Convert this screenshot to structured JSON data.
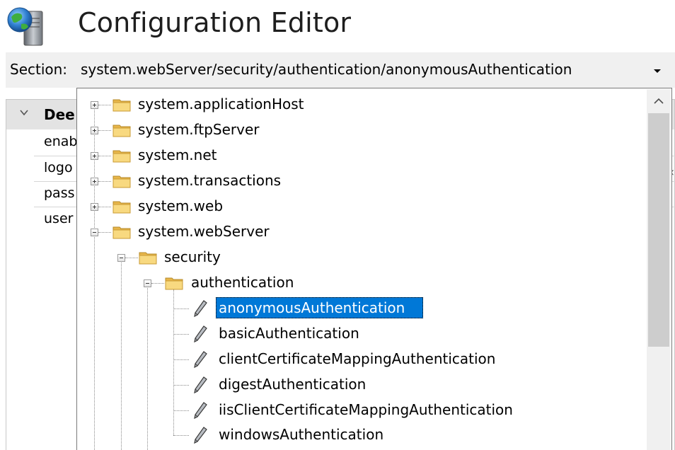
{
  "header": {
    "title": "Configuration Editor"
  },
  "section": {
    "label": "Section:",
    "value": "system.webServer/security/authentication/anonymousAuthentication"
  },
  "grid": {
    "group_label": "Dee",
    "rows": [
      "enab",
      "logo",
      "pass",
      "user"
    ]
  },
  "tree": {
    "nodes": [
      {
        "label": "system.applicationHost",
        "type": "folder",
        "state": "collapsed"
      },
      {
        "label": "system.ftpServer",
        "type": "folder",
        "state": "collapsed"
      },
      {
        "label": "system.net",
        "type": "folder",
        "state": "collapsed"
      },
      {
        "label": "system.transactions",
        "type": "folder",
        "state": "collapsed"
      },
      {
        "label": "system.web",
        "type": "folder",
        "state": "collapsed"
      },
      {
        "label": "system.webServer",
        "type": "folder",
        "state": "expanded"
      },
      {
        "label": "security",
        "type": "folder",
        "state": "expanded"
      },
      {
        "label": "authentication",
        "type": "folder",
        "state": "expanded"
      },
      {
        "label": "anonymousAuthentication",
        "type": "section",
        "selected": true
      },
      {
        "label": "basicAuthentication",
        "type": "section"
      },
      {
        "label": "clientCertificateMappingAuthentication",
        "type": "section"
      },
      {
        "label": "digestAuthentication",
        "type": "section"
      },
      {
        "label": "iisClientCertificateMappingAuthentication",
        "type": "section"
      },
      {
        "label": "windowsAuthentication",
        "type": "section"
      }
    ]
  },
  "colors": {
    "selection": "#0078d7",
    "folder": "#f5d47a",
    "bar_background": "#f0f0f0"
  },
  "icons": {
    "app": "configuration-globe-server-icon",
    "folder": "folder-icon",
    "section": "pen-icon"
  }
}
